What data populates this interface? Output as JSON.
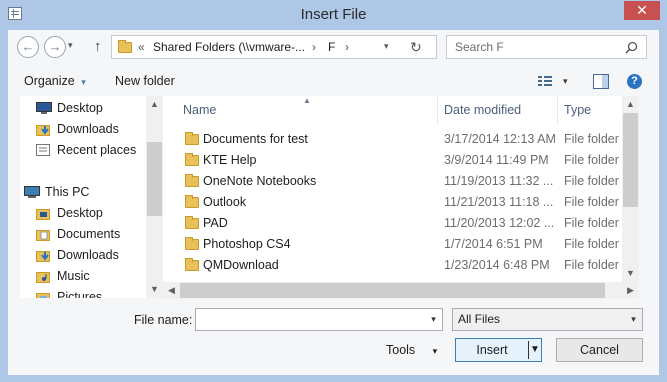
{
  "window": {
    "title": "Insert File",
    "close_glyph": "✕"
  },
  "address": {
    "crumbs_prefix": "«",
    "path_part1": "Shared Folders (\\\\vmware-...",
    "path_part2": "F",
    "separator": "›",
    "refresh_glyph": "↻"
  },
  "search": {
    "placeholder": "Search F",
    "icon": "search-icon"
  },
  "nav": {
    "back_glyph": "←",
    "forward_glyph": "→",
    "up_glyph": "↑",
    "recent_glyph": "▾"
  },
  "toolbar": {
    "organize_label": "Organize",
    "new_folder_label": "New folder",
    "help_glyph": "?"
  },
  "sidebar": {
    "items": [
      {
        "label": "Desktop",
        "icon": "desktop-icon"
      },
      {
        "label": "Downloads",
        "icon": "downloads-icon"
      },
      {
        "label": "Recent places",
        "icon": "recent-places-icon"
      },
      {
        "label": "This PC",
        "icon": "computer-icon"
      },
      {
        "label": "Desktop",
        "icon": "desktop-icon"
      },
      {
        "label": "Documents",
        "icon": "documents-icon"
      },
      {
        "label": "Downloads",
        "icon": "downloads-icon"
      },
      {
        "label": "Music",
        "icon": "music-icon"
      },
      {
        "label": "Pictures",
        "icon": "pictures-icon"
      }
    ]
  },
  "files": {
    "columns": {
      "name": "Name",
      "date": "Date modified",
      "type": "Type"
    },
    "rows": [
      {
        "name": "Documents for test",
        "date": "3/17/2014 12:13 AM",
        "type": "File folder"
      },
      {
        "name": "KTE Help",
        "date": "3/9/2014 11:49 PM",
        "type": "File folder"
      },
      {
        "name": "OneNote Notebooks",
        "date": "11/19/2013 11:32 ...",
        "type": "File folder"
      },
      {
        "name": "Outlook",
        "date": "11/21/2013 11:18 ...",
        "type": "File folder"
      },
      {
        "name": "PAD",
        "date": "11/20/2013 12:02 ...",
        "type": "File folder"
      },
      {
        "name": "Photoshop CS4",
        "date": "1/7/2014 6:51 PM",
        "type": "File folder"
      },
      {
        "name": "QMDownload",
        "date": "1/23/2014 6:48 PM",
        "type": "File folder"
      }
    ]
  },
  "footer": {
    "file_name_label": "File name:",
    "file_name_value": "",
    "file_type_value": "All Files",
    "tools_label": "Tools",
    "insert_label": "Insert",
    "cancel_label": "Cancel"
  },
  "colors": {
    "title_bar": "#aec7e6",
    "close_button": "#c75050",
    "folder": "#e8c15a",
    "accent": "#3c7fb1"
  }
}
